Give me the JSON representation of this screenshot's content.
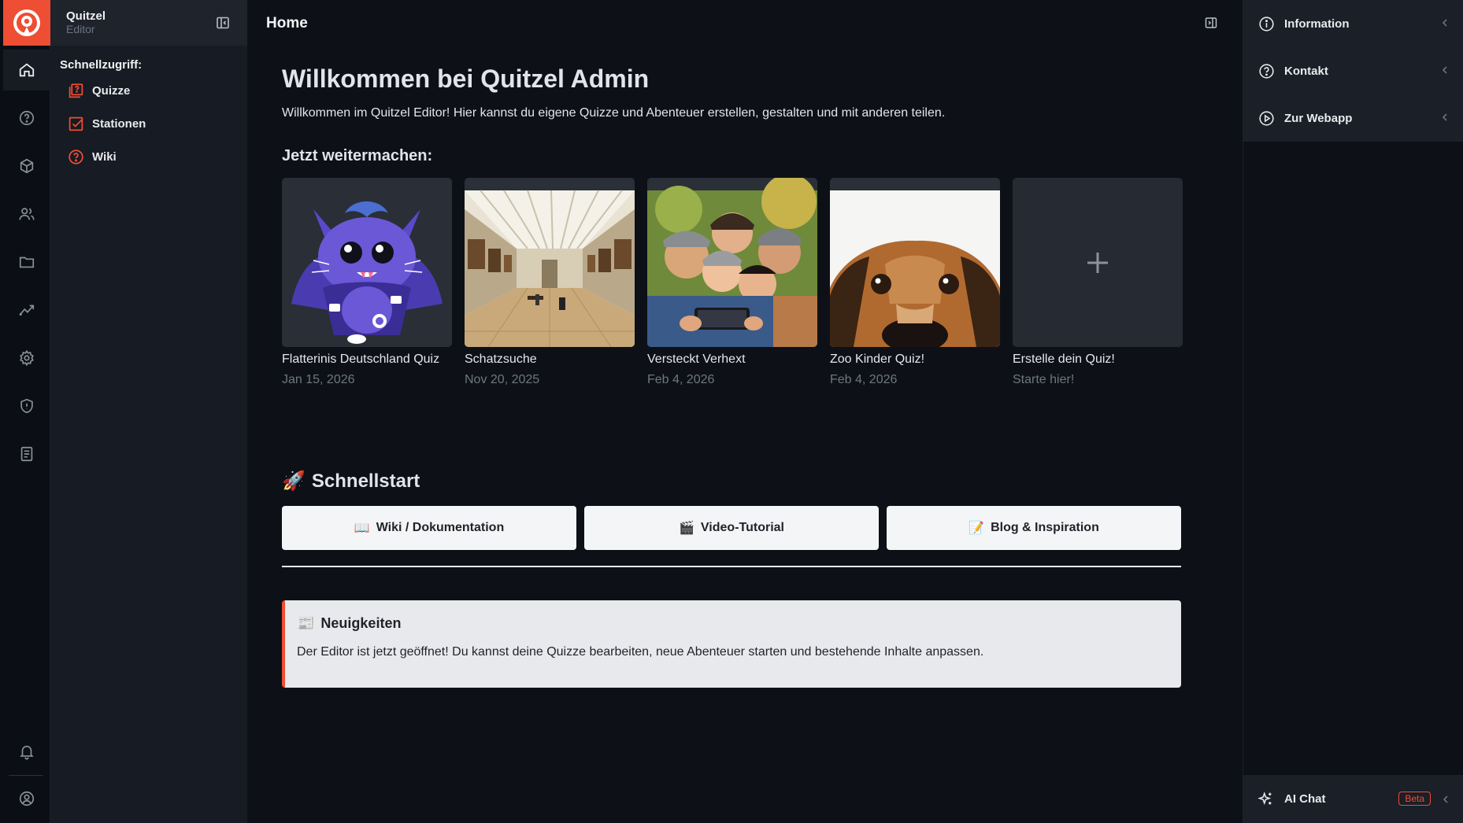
{
  "app": {
    "name": "Quitzel",
    "subtitle": "Editor",
    "accent": "#ee4e33"
  },
  "rail": {
    "items": [
      {
        "icon": "home-icon",
        "active": true
      },
      {
        "icon": "help-circle-icon"
      },
      {
        "icon": "cube-icon"
      },
      {
        "icon": "users-icon"
      },
      {
        "icon": "folder-icon"
      },
      {
        "icon": "trend-chart-icon"
      },
      {
        "icon": "settings-gear-icon"
      },
      {
        "icon": "shield-icon"
      },
      {
        "icon": "document-list-icon"
      }
    ],
    "bottom": [
      {
        "icon": "bell-icon"
      },
      {
        "icon": "user-circle-icon"
      }
    ]
  },
  "sidebar": {
    "title": "Schnellzugriff:",
    "items": [
      {
        "label": "Quizze",
        "icon": "quiz-icon"
      },
      {
        "label": "Stationen",
        "icon": "checkbox-icon"
      },
      {
        "label": "Wiki",
        "icon": "question-icon"
      }
    ]
  },
  "header": {
    "title": "Home"
  },
  "welcome": {
    "heading": "Willkommen bei Quitzel Admin",
    "text": "Willkommen im Quitzel Editor! Hier kannst du eigene Quizze und Abenteuer erstellen, gestalten und mit anderen teilen."
  },
  "continue": {
    "heading": "Jetzt weitermachen:",
    "cards": [
      {
        "title": "Flatterinis Deutschland Quiz",
        "date": "Jan 15, 2026",
        "image": "bat-mascot-illustration"
      },
      {
        "title": "Schatzsuche",
        "date": "Nov 20, 2025",
        "image": "museum-gallery-photo"
      },
      {
        "title": "Versteckt Verhext",
        "date": "Feb 4, 2026",
        "image": "group-selfie-photo"
      },
      {
        "title": "Zoo Kinder Quiz!",
        "date": "Feb 4, 2026",
        "image": "dog-closeup-photo"
      },
      {
        "title": "Erstelle dein Quiz!",
        "date": "Starte hier!",
        "image": "plus-icon"
      }
    ]
  },
  "quickstart": {
    "emoji": "🚀",
    "heading": "Schnellstart",
    "buttons": [
      {
        "emoji": "📖",
        "label": "Wiki / Dokumentation"
      },
      {
        "emoji": "🎬",
        "label": "Video-Tutorial"
      },
      {
        "emoji": "📝",
        "label": "Blog & Inspiration"
      }
    ]
  },
  "news": {
    "emoji": "📰",
    "heading": "Neuigkeiten",
    "text": "Der Editor ist jetzt geöffnet! Du kannst deine Quizze bearbeiten, neue Abenteuer starten und bestehende Inhalte anpassen."
  },
  "right_panel": {
    "items": [
      {
        "label": "Information",
        "icon": "info-icon"
      },
      {
        "label": "Kontakt",
        "icon": "question-icon"
      },
      {
        "label": "Zur Webapp",
        "icon": "play-circle-icon"
      }
    ],
    "ai_chat": {
      "label": "AI Chat",
      "badge": "Beta",
      "icon": "sparkle-icon"
    }
  }
}
